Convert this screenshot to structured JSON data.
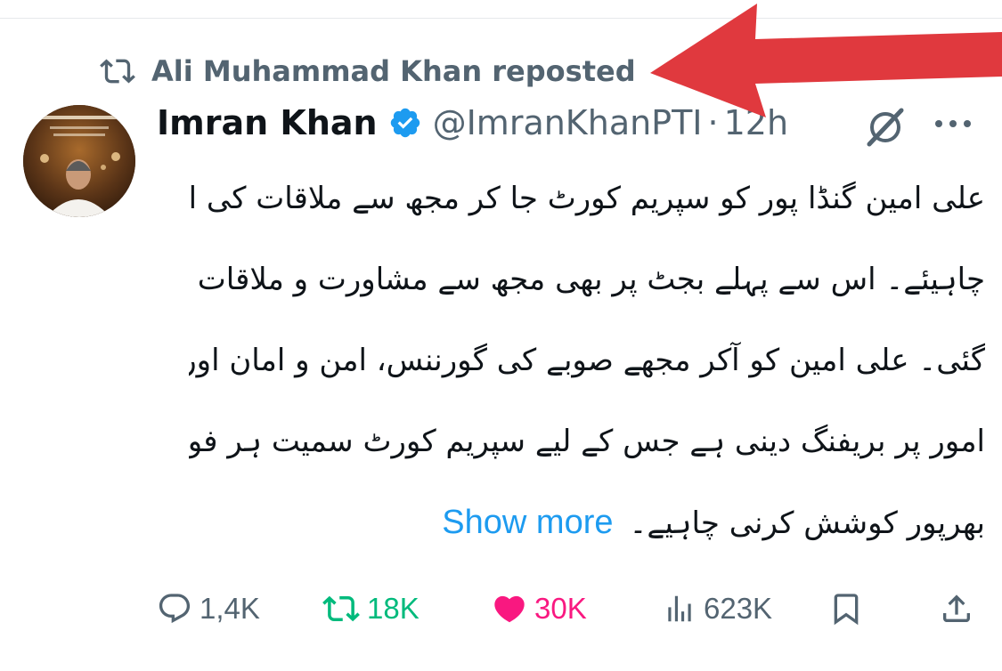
{
  "repost": {
    "icon": "repost-icon",
    "text": "Ali Muhammad Khan reposted"
  },
  "author": {
    "name": "Imran Khan",
    "handle": "@ImranKhanPTI",
    "separator": "·",
    "time": "12h",
    "verified_color": "#1d9bf0"
  },
  "tweet": {
    "lines": [
      "علی امین گنڈا پور کو سپریم کورٹ جا کر مجھ سے ملاقات کی اجازت مانگنی",
      "چاہیئے۔ اس سے پہلے بجٹ پر بھی مجھ سے مشاورت و ملاقات نہیں کی",
      "گئی۔ علی امین کو آکر مجھے صوبے کی گورننس، امن و امان اور دیگر اہم",
      "امور پر بریفنگ دینی ہے جس کے لیے سپریم کورٹ سمیت ہر فورم پر",
      "بھرپور کوشش کرنی چاہیے۔"
    ],
    "show_more": "Show more"
  },
  "actions": {
    "reply_count": "1,4K",
    "repost_count": "18K",
    "like_count": "30K",
    "views_count": "623K"
  },
  "colors": {
    "accent": "#1d9bf0",
    "repost_green": "#00ba7c",
    "like_pink": "#f91880",
    "muted": "#536471",
    "annotation_arrow": "#e0393e"
  }
}
